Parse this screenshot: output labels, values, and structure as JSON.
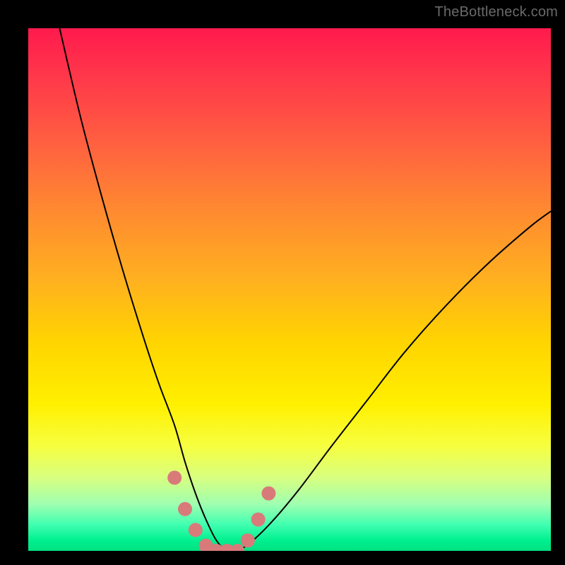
{
  "watermark": "TheBottleneck.com",
  "chart_data": {
    "type": "line",
    "title": "",
    "xlabel": "",
    "ylabel": "",
    "xlim": [
      0,
      100
    ],
    "ylim": [
      0,
      100
    ],
    "background_gradient": {
      "top_color": "#ff1a4d",
      "mid_color": "#ffe000",
      "bottom_color": "#00e080",
      "meaning": "red = high bottleneck, green = low bottleneck"
    },
    "series": [
      {
        "name": "bottleneck-curve",
        "color": "#000000",
        "stroke_width": 2,
        "x": [
          6,
          10,
          14,
          18,
          22,
          25,
          28,
          30,
          32,
          34,
          36,
          38,
          40,
          43,
          47,
          52,
          58,
          65,
          72,
          80,
          88,
          96,
          100
        ],
        "y": [
          100,
          83,
          68,
          54,
          41,
          32,
          24,
          17,
          11,
          6,
          2,
          0,
          0,
          2,
          6,
          12,
          20,
          29,
          38,
          47,
          55,
          62,
          65
        ]
      },
      {
        "name": "highlight-points",
        "color": "#d97a7a",
        "marker": "circle",
        "marker_radius": 10,
        "x": [
          28,
          30,
          32,
          34,
          36,
          38,
          40,
          42,
          44,
          46
        ],
        "y": [
          14,
          8,
          4,
          1,
          0,
          0,
          0,
          2,
          6,
          11
        ]
      }
    ],
    "optimum_x": 38
  }
}
